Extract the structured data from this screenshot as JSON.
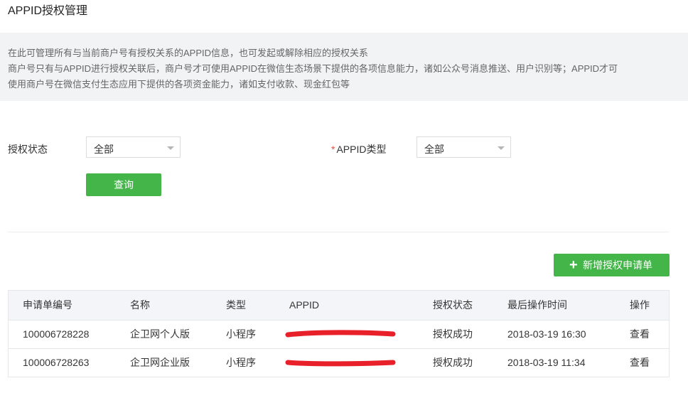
{
  "header": {
    "title": "APPID授权管理"
  },
  "info": {
    "line1": "在此可管理所有与当前商户号有授权关系的APPID信息，也可发起或解除相应的授权关系",
    "line2": "商户号只有与APPID进行授权关联后，商户号才可使用APPID在微信生态场景下提供的各项信息能力，诸如公众号消息推送、用户识别等；APPID才可",
    "line3": "使用商户号在微信支付生态应用下提供的各项资金能力，诸如支付收款、现金红包等"
  },
  "filters": {
    "status_label": "授权状态",
    "status_value": "全部",
    "type_required_mark": "*",
    "type_label": "APPID类型",
    "type_value": "全部",
    "query_button": "查询"
  },
  "actions": {
    "add_button": "新增授权申请单"
  },
  "table": {
    "headers": [
      "申请单编号",
      "名称",
      "类型",
      "APPID",
      "授权状态",
      "最后操作时间",
      "操作"
    ],
    "rows": [
      {
        "id": "100006728228",
        "name": "企卫网个人版",
        "type": "小程序",
        "status": "授权成功",
        "time": "2018-03-19 16:30",
        "action": "查看"
      },
      {
        "id": "100006728263",
        "name": "企卫网企业版",
        "type": "小程序",
        "status": "授权成功",
        "time": "2018-03-19 11:34",
        "action": "查看"
      }
    ]
  },
  "colors": {
    "accent_green": "#44b549",
    "link_blue": "#459ae9",
    "redaction_red": "#e8202a",
    "required_red": "#e34d3d"
  },
  "icons": {
    "add": "plus-icon",
    "dropdown": "caret-down-icon"
  }
}
